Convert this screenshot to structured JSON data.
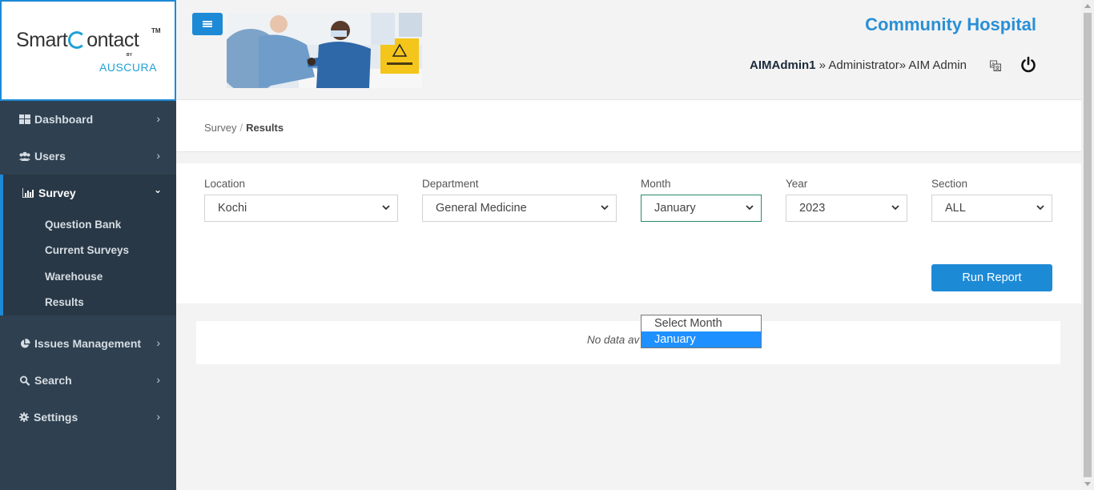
{
  "brand": {
    "name_part1": "Smart",
    "name_part2": "ontact",
    "tm": "TM",
    "by": "BY",
    "sub": "AUSCURA"
  },
  "sidebar": {
    "items": [
      {
        "label": "Dashboard",
        "icon": "dashboard-icon"
      },
      {
        "label": "Users",
        "icon": "users-icon"
      },
      {
        "label": "Survey",
        "icon": "bar-chart-icon",
        "active": true,
        "children": [
          "Question Bank",
          "Current Surveys",
          "Warehouse",
          "Results"
        ]
      },
      {
        "label": "Issues Management",
        "icon": "pie-chart-icon"
      },
      {
        "label": "Search",
        "icon": "search-icon"
      },
      {
        "label": "Settings",
        "icon": "gear-icon"
      }
    ]
  },
  "header": {
    "hospital": "Community Hospital",
    "user": "AIMAdmin1",
    "sep1": " » ",
    "role": "Administrator",
    "sep2": "» ",
    "org": "AIM Admin"
  },
  "breadcrumb": {
    "parent": "Survey",
    "separator": "/",
    "current": "Results"
  },
  "filters": {
    "location": {
      "label": "Location",
      "value": "Kochi"
    },
    "department": {
      "label": "Department",
      "value": "General Medicine"
    },
    "month": {
      "label": "Month",
      "value": "January"
    },
    "year": {
      "label": "Year",
      "value": "2023"
    },
    "section": {
      "label": "Section",
      "value": "ALL"
    }
  },
  "run_report_label": "Run Report",
  "results": {
    "empty_text": "No data av"
  },
  "month_dropdown": {
    "options": [
      "Select Month",
      "January"
    ],
    "selected_index": 1
  },
  "colors": {
    "primary": "#1d8ad6",
    "sidebar_bg": "#2f4050",
    "title": "#2a8fd5",
    "highlight": "#1e90ff"
  }
}
